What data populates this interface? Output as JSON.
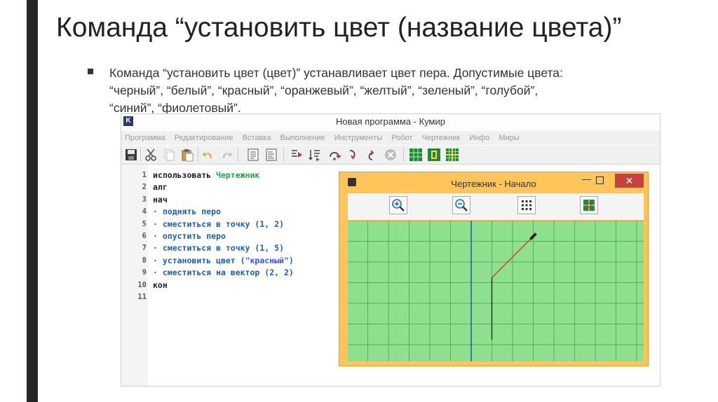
{
  "slide": {
    "title": "Команда “установить цвет (название цвета)”",
    "bullet_lines": [
      "Команда “установить цвет (цвет)” устанавливает цвет пера. Допустимые цвета:",
      "“черный”, “белый”, “красный”, “оранжевый”, “желтый”, “зеленый”, “голубой”,",
      "“синий”, “фиолетовый”."
    ]
  },
  "window": {
    "icon_letter": "K",
    "title": "Новая программа - Кумир",
    "menu": [
      "Программа",
      "Редактирование",
      "Вставка",
      "Выполнение",
      "Инструменты",
      "Робот",
      "Чертежник",
      "Инфо",
      "Миры"
    ]
  },
  "editor": {
    "line_numbers": [
      "1",
      "2",
      "3",
      "4",
      "5",
      "6",
      "7",
      "8",
      "9",
      "10",
      "11"
    ],
    "lines": [
      {
        "parts": [
          {
            "t": "использовать ",
            "c": "plain"
          },
          {
            "t": "Чертежник",
            "c": "kw-green"
          }
        ]
      },
      {
        "parts": [
          {
            "t": "алг",
            "c": "plain"
          }
        ]
      },
      {
        "parts": [
          {
            "t": "нач",
            "c": "plain"
          }
        ]
      },
      {
        "parts": [
          {
            "t": "· ",
            "c": "dot"
          },
          {
            "t": "поднять перо",
            "c": "kw-blue"
          }
        ]
      },
      {
        "parts": [
          {
            "t": "· ",
            "c": "dot"
          },
          {
            "t": "сместиться в точку (",
            "c": "kw-blue"
          },
          {
            "t": "1",
            "c": "num"
          },
          {
            "t": ", ",
            "c": "kw-blue"
          },
          {
            "t": "2",
            "c": "num"
          },
          {
            "t": ")",
            "c": "kw-blue"
          }
        ]
      },
      {
        "parts": [
          {
            "t": "· ",
            "c": "dot"
          },
          {
            "t": "опустить перо",
            "c": "kw-blue"
          }
        ]
      },
      {
        "parts": [
          {
            "t": "· ",
            "c": "dot"
          },
          {
            "t": "сместиться в точку (",
            "c": "kw-blue"
          },
          {
            "t": "1",
            "c": "num"
          },
          {
            "t": ", ",
            "c": "kw-blue"
          },
          {
            "t": "5",
            "c": "num"
          },
          {
            "t": ")",
            "c": "kw-blue"
          }
        ]
      },
      {
        "parts": [
          {
            "t": "· ",
            "c": "dot"
          },
          {
            "t": "установить цвет (",
            "c": "kw-blue"
          },
          {
            "t": "\"красный\"",
            "c": "str"
          },
          {
            "t": ")",
            "c": "kw-blue"
          }
        ]
      },
      {
        "parts": [
          {
            "t": "· ",
            "c": "dot"
          },
          {
            "t": "сместиться на вектор (",
            "c": "kw-blue"
          },
          {
            "t": "2",
            "c": "num"
          },
          {
            "t": ", ",
            "c": "kw-blue"
          },
          {
            "t": "2",
            "c": "num"
          },
          {
            "t": ")",
            "c": "kw-blue"
          }
        ]
      },
      {
        "parts": [
          {
            "t": "кон",
            "c": "plain"
          }
        ]
      },
      {
        "parts": []
      }
    ]
  },
  "drawer_window": {
    "title": "Чертежник - Начало",
    "close_glyph": "✕",
    "tools": [
      "zoom-in-icon",
      "zoom-out-icon",
      "grid-dots-icon",
      "fit-view-icon"
    ],
    "canvas": {
      "background": "#8ee08e",
      "grid_color": "#55b055",
      "axis_color": "#1f5fae",
      "segments": [
        {
          "from": [
            1,
            2
          ],
          "to": [
            1,
            5
          ],
          "color": "#222222"
        },
        {
          "from": [
            1,
            5
          ],
          "to": [
            3,
            7
          ],
          "color": "#d94020"
        }
      ],
      "pen_position": [
        3,
        7
      ]
    }
  }
}
